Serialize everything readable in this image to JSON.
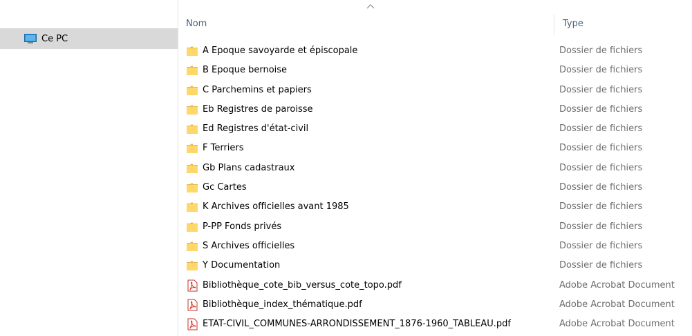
{
  "navigation": {
    "items": [
      {
        "label": "Ce PC",
        "icon": "computer-icon"
      }
    ]
  },
  "columns": {
    "name_label": "Nom",
    "type_label": "Type",
    "sorted_by": "Nom",
    "sort_direction": "ascending"
  },
  "files": [
    {
      "name": "A Epoque savoyarde et épiscopale",
      "type": "Dossier de fichiers",
      "icon": "folder-icon"
    },
    {
      "name": "B Epoque bernoise",
      "type": "Dossier de fichiers",
      "icon": "folder-icon"
    },
    {
      "name": "C Parchemins et papiers",
      "type": "Dossier de fichiers",
      "icon": "folder-icon"
    },
    {
      "name": "Eb Registres de paroisse",
      "type": "Dossier de fichiers",
      "icon": "folder-icon"
    },
    {
      "name": "Ed Registres d'état-civil",
      "type": "Dossier de fichiers",
      "icon": "folder-icon"
    },
    {
      "name": "F Terriers",
      "type": "Dossier de fichiers",
      "icon": "folder-icon"
    },
    {
      "name": "Gb Plans cadastraux",
      "type": "Dossier de fichiers",
      "icon": "folder-icon"
    },
    {
      "name": "Gc Cartes",
      "type": "Dossier de fichiers",
      "icon": "folder-icon"
    },
    {
      "name": "K Archives officielles avant 1985",
      "type": "Dossier de fichiers",
      "icon": "folder-icon"
    },
    {
      "name": "P-PP Fonds privés",
      "type": "Dossier de fichiers",
      "icon": "folder-icon"
    },
    {
      "name": "S Archives officielles",
      "type": "Dossier de fichiers",
      "icon": "folder-icon"
    },
    {
      "name": "Y Documentation",
      "type": "Dossier de fichiers",
      "icon": "folder-icon"
    },
    {
      "name": "Bibliothèque_cote_bib_versus_cote_topo.pdf",
      "type": "Adobe Acrobat Document",
      "icon": "pdf-icon"
    },
    {
      "name": "Bibliothèque_index_thématique.pdf",
      "type": "Adobe Acrobat Document",
      "icon": "pdf-icon"
    },
    {
      "name": "ETAT-CIVIL_COMMUNES-ARRONDISSEMENT_1876-1960_TABLEAU.pdf",
      "type": "Adobe Acrobat Document",
      "icon": "pdf-icon"
    }
  ],
  "colors": {
    "nav_selected_bg": "#d9d9d9",
    "header_text": "#4c607a",
    "type_text": "#6d6d6d",
    "folder_yellow": "#ffd86b",
    "pdf_red": "#d9352c"
  }
}
